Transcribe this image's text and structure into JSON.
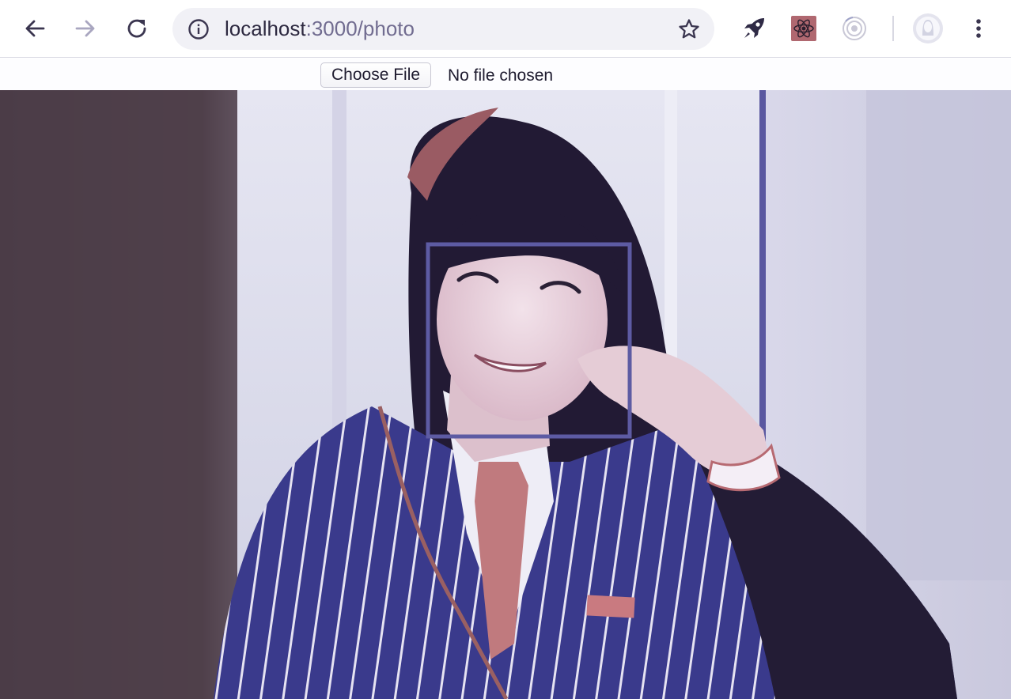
{
  "browser": {
    "url_host": "localhost",
    "url_path": ":3000/photo",
    "icons": {
      "back": "arrow-left-icon",
      "forward": "arrow-right-icon",
      "reload": "reload-icon",
      "info": "info-circle-icon",
      "bookmark": "star-icon",
      "ext1": "rocket-icon",
      "ext2": "react-devtools-icon",
      "ext3": "target-icon",
      "profile": "avatar-icon",
      "menu": "kebab-menu-icon"
    }
  },
  "file_input": {
    "button_label": "Choose File",
    "status": "No file chosen"
  },
  "detection": {
    "box_color": "#5d5ba3"
  }
}
